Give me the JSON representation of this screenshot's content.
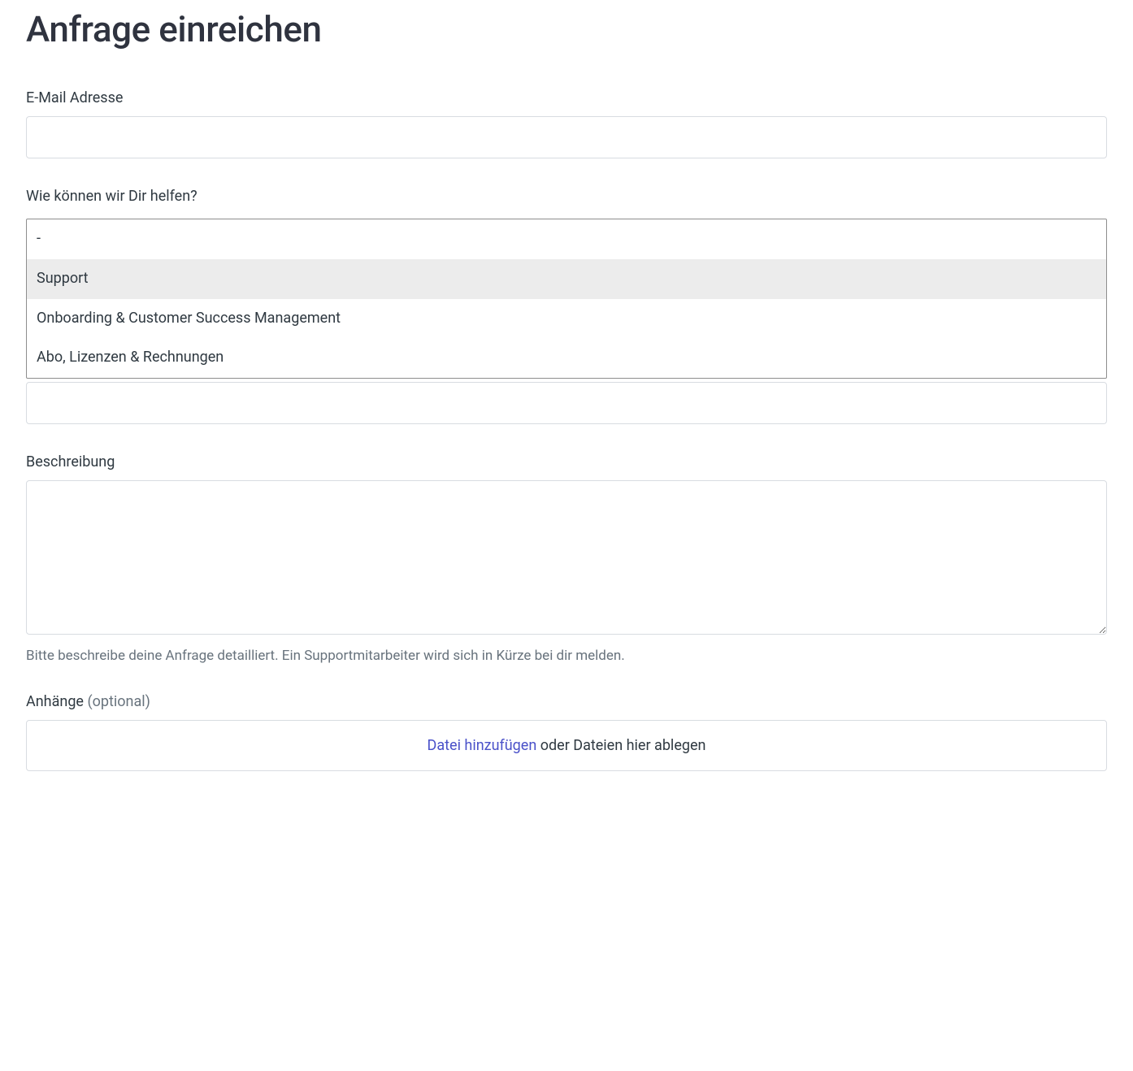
{
  "page": {
    "title": "Anfrage einreichen"
  },
  "fields": {
    "email": {
      "label": "E-Mail Adresse",
      "value": ""
    },
    "help_topic": {
      "label": "Wie können wir Dir helfen?",
      "placeholder_option": "-",
      "options": [
        "Support",
        "Onboarding & Customer Success Management",
        "Abo, Lizenzen & Rechnungen"
      ],
      "highlighted_index": 0
    },
    "hidden_field": {
      "value": ""
    },
    "description": {
      "label": "Beschreibung",
      "value": "",
      "helper": "Bitte beschreibe deine Anfrage detailliert. Ein Supportmitarbeiter wird sich in Kürze bei dir melden."
    },
    "attachments": {
      "label": "Anhänge",
      "optional_suffix": "(optional)",
      "link_text": "Datei hinzufügen",
      "rest_text": " oder Dateien hier ablegen"
    }
  }
}
